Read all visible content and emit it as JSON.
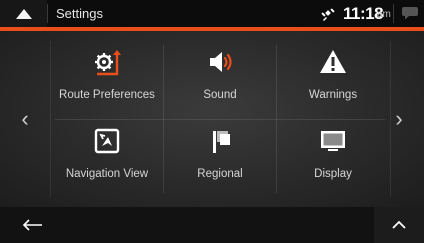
{
  "statusbar": {
    "title": "Settings",
    "time": "11:18",
    "ampm": "am",
    "icons": {
      "home": "home-triangle-icon",
      "gps": "satellite-icon",
      "messages": "message-bubble-icon"
    }
  },
  "colors": {
    "accent": "#e94e1b",
    "background": "#2e2e2e",
    "text": "#d6d6d6"
  },
  "menu": {
    "items": [
      {
        "label": "Route Preferences",
        "icon": "route-preferences-icon"
      },
      {
        "label": "Sound",
        "icon": "speaker-icon"
      },
      {
        "label": "Warnings",
        "icon": "warning-icon"
      },
      {
        "label": "Navigation View",
        "icon": "navigation-view-icon"
      },
      {
        "label": "Regional",
        "icon": "regional-flag-icon"
      },
      {
        "label": "Display",
        "icon": "display-icon"
      }
    ],
    "prev_glyph": "‹",
    "next_glyph": "›"
  },
  "bottombar": {
    "back": "back-arrow-icon",
    "up": "up-chevron-icon"
  }
}
